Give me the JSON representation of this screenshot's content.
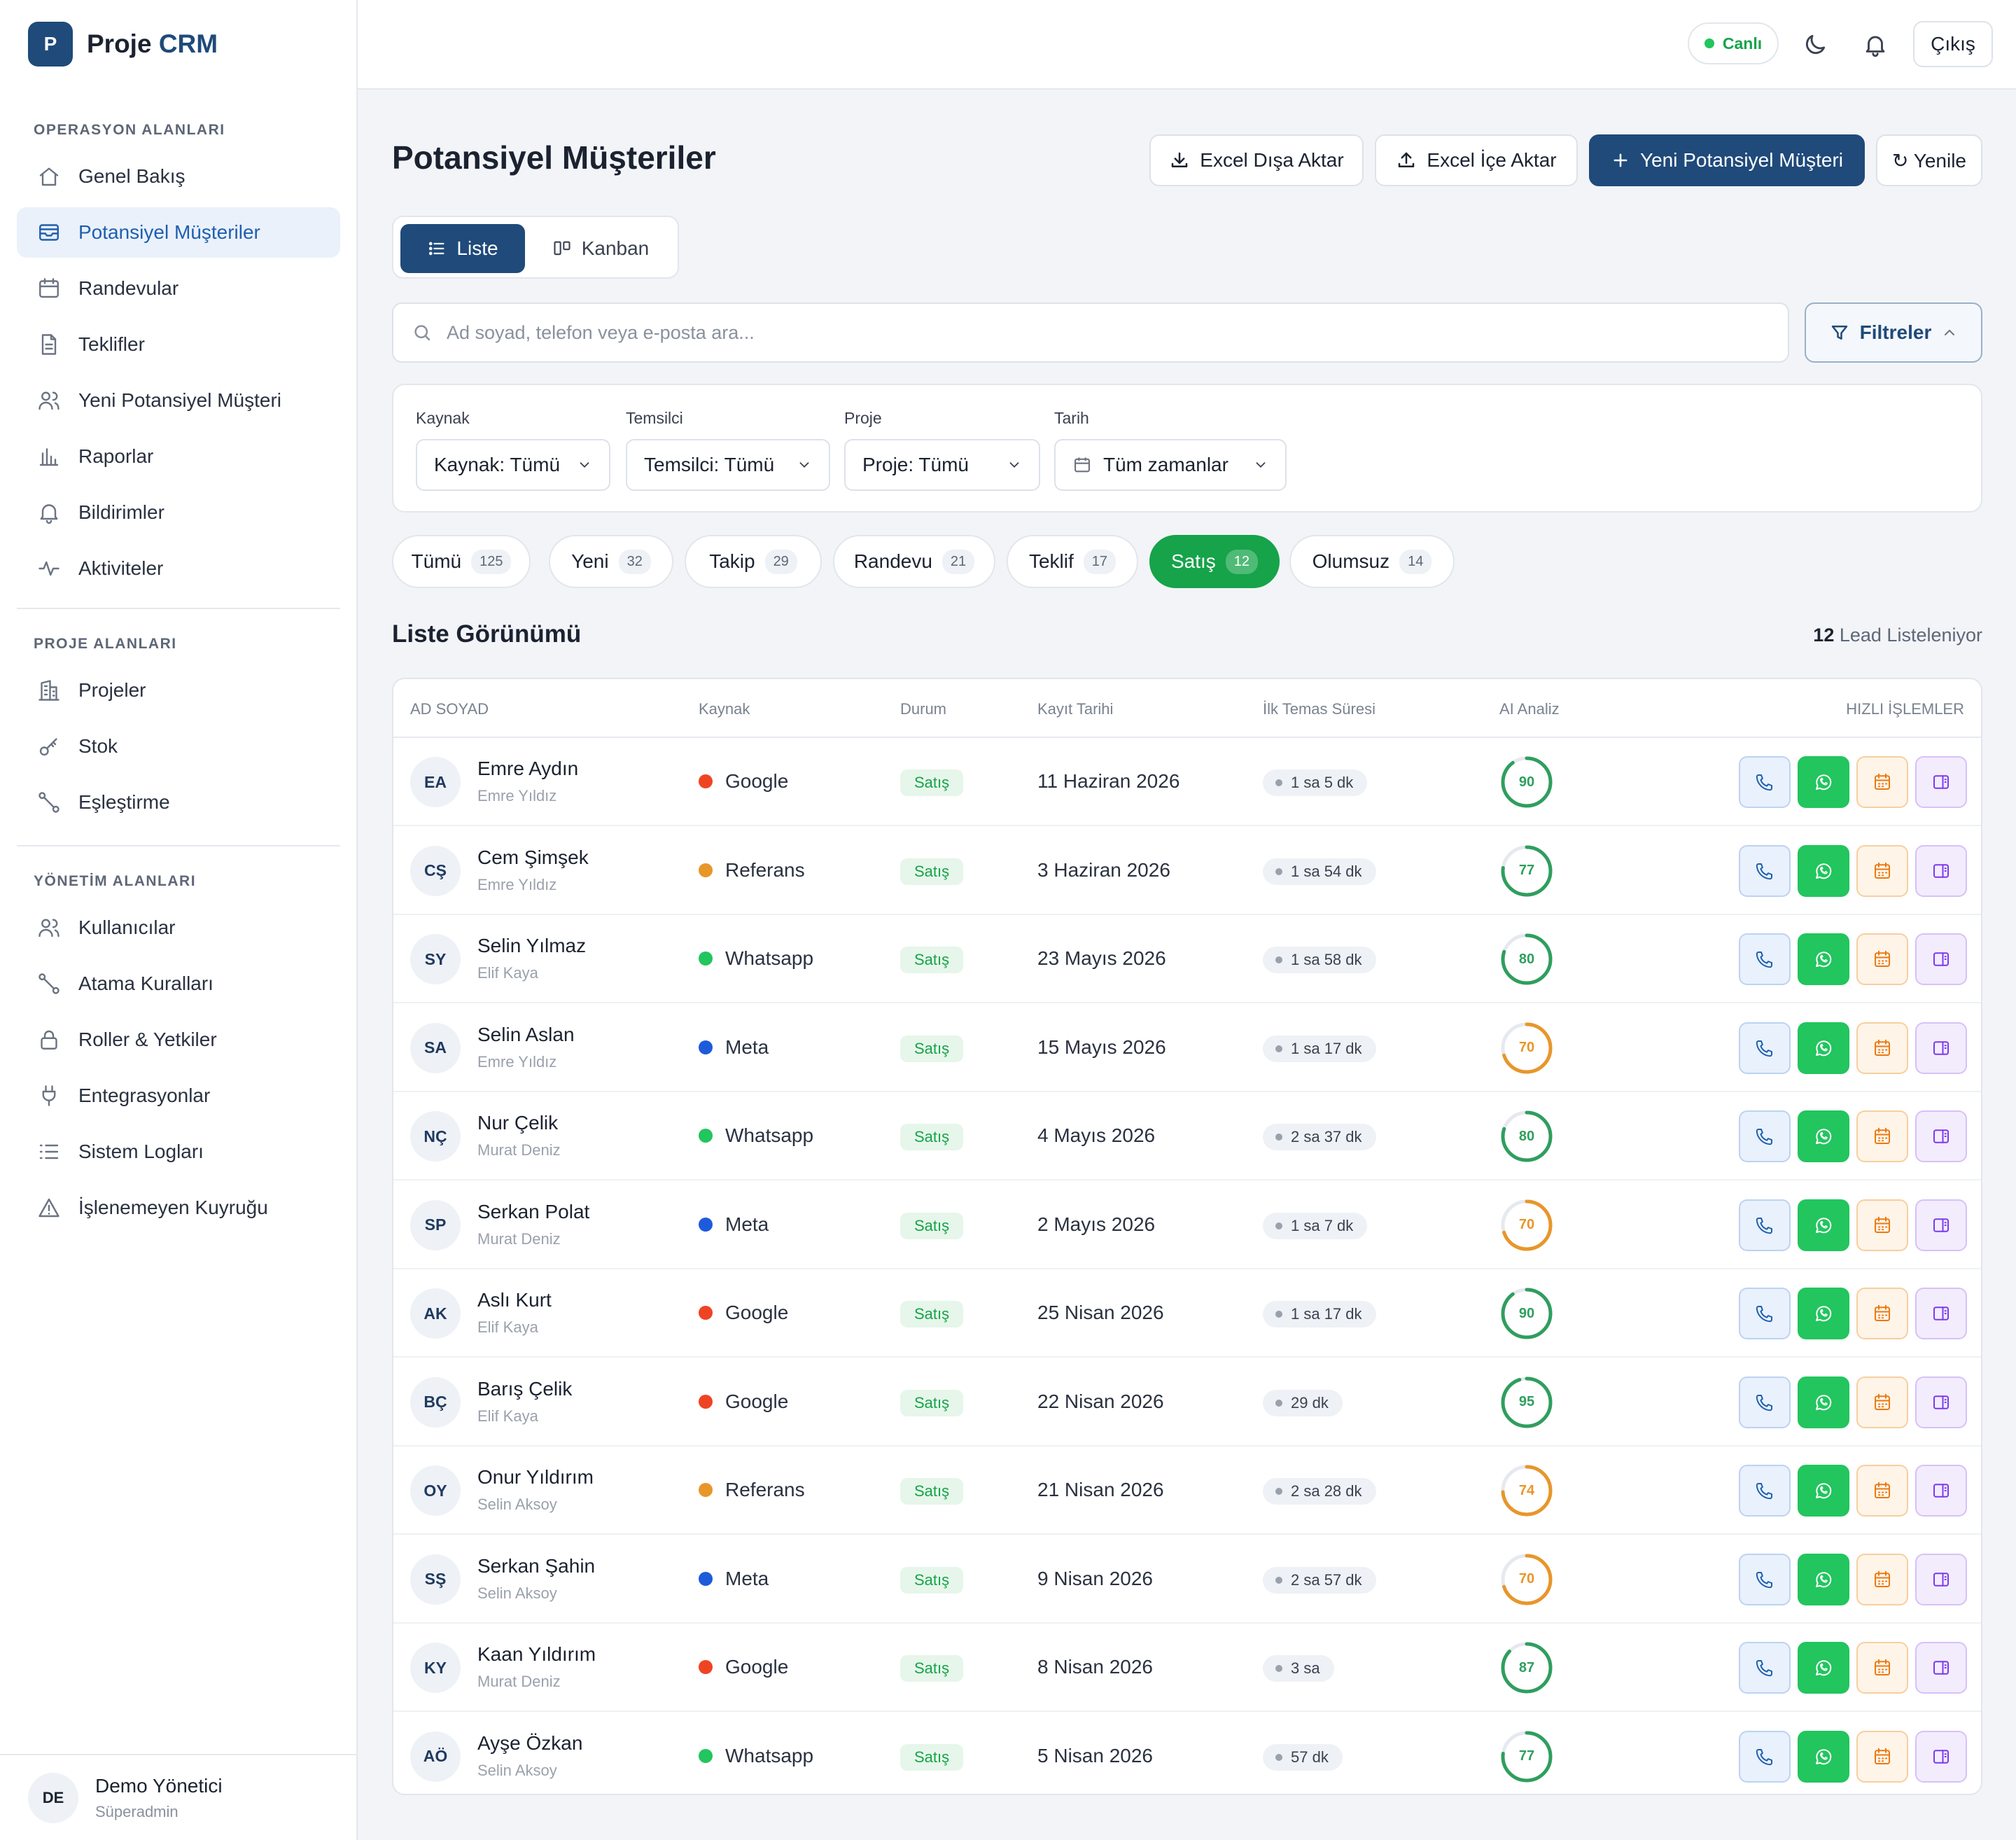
{
  "app": {
    "logo_letter": "P",
    "name_part1": "Proje",
    "name_part2": "CRM"
  },
  "sidebar": {
    "sections": [
      {
        "title": "OPERASYON ALANLARI",
        "items": [
          {
            "label": "Genel Bakış",
            "icon": "home-icon"
          },
          {
            "label": "Potansiyel Müşteriler",
            "icon": "inbox-icon",
            "active": true
          },
          {
            "label": "Randevular",
            "icon": "calendar-icon"
          },
          {
            "label": "Teklifler",
            "icon": "document-icon"
          },
          {
            "label": "Yeni Potansiyel Müşteri",
            "icon": "users-icon"
          },
          {
            "label": "Raporlar",
            "icon": "bar-chart-icon"
          },
          {
            "label": "Bildirimler",
            "icon": "bell-icon"
          },
          {
            "label": "Aktiviteler",
            "icon": "activity-icon"
          }
        ]
      },
      {
        "title": "PROJE ALANLARI",
        "items": [
          {
            "label": "Projeler",
            "icon": "building-icon"
          },
          {
            "label": "Stok",
            "icon": "key-icon"
          },
          {
            "label": "Eşleştirme",
            "icon": "route-icon"
          }
        ]
      },
      {
        "title": "YÖNETİM ALANLARI",
        "items": [
          {
            "label": "Kullanıcılar",
            "icon": "users-icon"
          },
          {
            "label": "Atama Kuralları",
            "icon": "route-icon"
          },
          {
            "label": "Roller & Yetkiler",
            "icon": "lock-icon"
          },
          {
            "label": "Entegrasyonlar",
            "icon": "plug-icon"
          },
          {
            "label": "Sistem Logları",
            "icon": "list-icon"
          },
          {
            "label": "İşlenemeyen Kuyruğu",
            "icon": "warning-icon"
          }
        ]
      }
    ],
    "user": {
      "initials": "DE",
      "name": "Demo Yönetici",
      "role": "Süperadmin"
    }
  },
  "topbar": {
    "live_label": "Canlı",
    "logout_label": "Çıkış"
  },
  "page": {
    "title": "Potansiyel Müşteriler",
    "export_label": "Excel Dışa Aktar",
    "import_label": "Excel İçe Aktar",
    "new_label": "Yeni Potansiyel Müşteri",
    "refresh_label": "↻ Yenile"
  },
  "view_toggle": {
    "list_label": "Liste",
    "kanban_label": "Kanban"
  },
  "search": {
    "placeholder": "Ad soyad, telefon veya e-posta ara...",
    "value": ""
  },
  "filters": {
    "button_label": "Filtreler",
    "groups": [
      {
        "label": "Kaynak",
        "value": "Kaynak: Tümü"
      },
      {
        "label": "Temsilci",
        "value": "Temsilci: Tümü"
      },
      {
        "label": "Proje",
        "value": "Proje: Tümü"
      },
      {
        "label": "Tarih",
        "value": "Tüm zamanlar"
      }
    ]
  },
  "status_tabs": [
    {
      "label": "Tümü",
      "count": "125"
    },
    {
      "label": "Yeni",
      "count": "32"
    },
    {
      "label": "Takip",
      "count": "29"
    },
    {
      "label": "Randevu",
      "count": "21"
    },
    {
      "label": "Teklif",
      "count": "17"
    },
    {
      "label": "Satış",
      "count": "12",
      "active": true
    },
    {
      "label": "Olumsuz",
      "count": "14"
    }
  ],
  "list": {
    "title": "Liste Görünümü",
    "count": "12",
    "count_suffix": "Lead Listeleniyor"
  },
  "table": {
    "headers": [
      "AD SOYAD",
      "Kaynak",
      "Durum",
      "Kayıt Tarihi",
      "İlk Temas Süresi",
      "AI Analiz",
      "HIZLI İŞLEMLER"
    ],
    "colors": {
      "Google": "#ef4423",
      "Referans": "#e8962a",
      "Whatsapp": "#22c55e",
      "Meta": "#1d5bdb",
      "score_high": "#2f9e5e",
      "score_mid": "#e8962a"
    },
    "rows": [
      {
        "initials": "EA",
        "name": "Emre Aydın",
        "agent": "Emre Yıldız",
        "source": "Google",
        "status": "Satış",
        "date": "11 Haziran 2026",
        "first_contact": "1 sa 5 dk",
        "score": 90
      },
      {
        "initials": "CŞ",
        "name": "Cem Şimşek",
        "agent": "Emre Yıldız",
        "source": "Referans",
        "status": "Satış",
        "date": "3 Haziran 2026",
        "first_contact": "1 sa 54 dk",
        "score": 77
      },
      {
        "initials": "SY",
        "name": "Selin Yılmaz",
        "agent": "Elif Kaya",
        "source": "Whatsapp",
        "status": "Satış",
        "date": "23 Mayıs 2026",
        "first_contact": "1 sa 58 dk",
        "score": 80
      },
      {
        "initials": "SA",
        "name": "Selin Aslan",
        "agent": "Emre Yıldız",
        "source": "Meta",
        "status": "Satış",
        "date": "15 Mayıs 2026",
        "first_contact": "1 sa 17 dk",
        "score": 70
      },
      {
        "initials": "NÇ",
        "name": "Nur Çelik",
        "agent": "Murat Deniz",
        "source": "Whatsapp",
        "status": "Satış",
        "date": "4 Mayıs 2026",
        "first_contact": "2 sa 37 dk",
        "score": 80
      },
      {
        "initials": "SP",
        "name": "Serkan Polat",
        "agent": "Murat Deniz",
        "source": "Meta",
        "status": "Satış",
        "date": "2 Mayıs 2026",
        "first_contact": "1 sa 7 dk",
        "score": 70
      },
      {
        "initials": "AK",
        "name": "Aslı Kurt",
        "agent": "Elif Kaya",
        "source": "Google",
        "status": "Satış",
        "date": "25 Nisan 2026",
        "first_contact": "1 sa 17 dk",
        "score": 90
      },
      {
        "initials": "BÇ",
        "name": "Barış Çelik",
        "agent": "Elif Kaya",
        "source": "Google",
        "status": "Satış",
        "date": "22 Nisan 2026",
        "first_contact": "29 dk",
        "score": 95
      },
      {
        "initials": "OY",
        "name": "Onur Yıldırım",
        "agent": "Selin Aksoy",
        "source": "Referans",
        "status": "Satış",
        "date": "21 Nisan 2026",
        "first_contact": "2 sa 28 dk",
        "score": 74
      },
      {
        "initials": "SŞ",
        "name": "Serkan Şahin",
        "agent": "Selin Aksoy",
        "source": "Meta",
        "status": "Satış",
        "date": "9 Nisan 2026",
        "first_contact": "2 sa 57 dk",
        "score": 70
      },
      {
        "initials": "KY",
        "name": "Kaan Yıldırım",
        "agent": "Murat Deniz",
        "source": "Google",
        "status": "Satış",
        "date": "8 Nisan 2026",
        "first_contact": "3 sa",
        "score": 87
      },
      {
        "initials": "AÖ",
        "name": "Ayşe Özkan",
        "agent": "Selin Aksoy",
        "source": "Whatsapp",
        "status": "Satış",
        "date": "5 Nisan 2026",
        "first_contact": "57 dk",
        "score": 77
      }
    ]
  }
}
